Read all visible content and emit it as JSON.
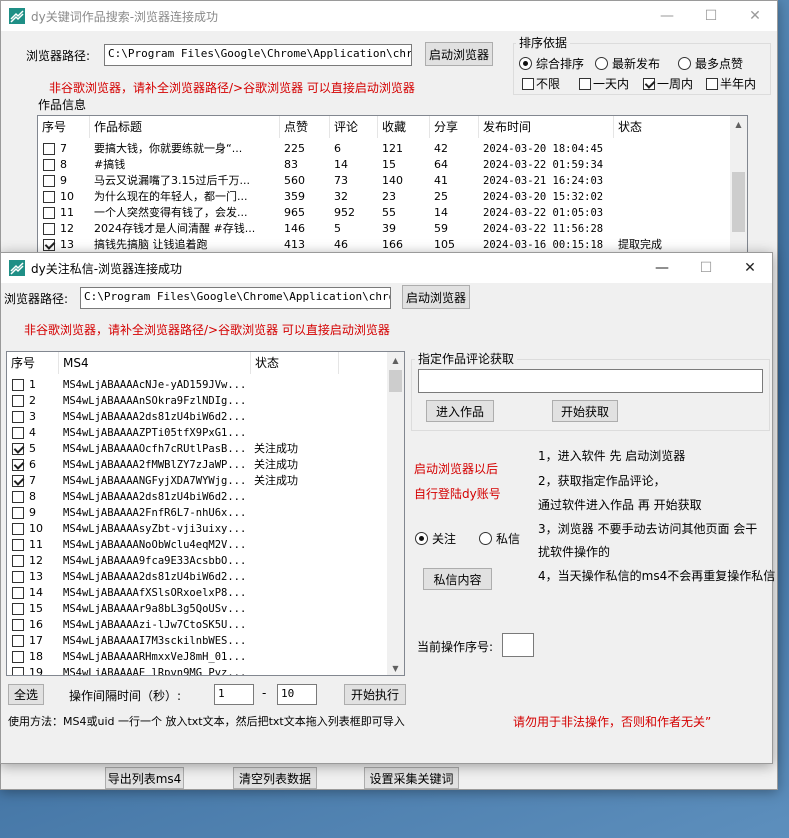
{
  "win1": {
    "title": "dy关键词作品搜索-浏览器连接成功",
    "minimize": "—",
    "maximize": "☐",
    "close": "✕",
    "browser_label": "浏览器路径:",
    "browser_path": "C:\\Program Files\\Google\\Chrome\\Application\\chrome.e",
    "launch_button": "启动浏览器",
    "notice": "非谷歌浏览器，请补全浏览器路径/>谷歌浏览器 可以直接启动浏览器",
    "works_label": "作品信息",
    "sort": {
      "title": "排序依据",
      "options": [
        "综合排序",
        "最新发布",
        "最多点赞"
      ],
      "selected": 0,
      "time_filters": [
        {
          "label": "不限",
          "checked": false
        },
        {
          "label": "一天内",
          "checked": false
        },
        {
          "label": "一周内",
          "checked": true
        },
        {
          "label": "半年内",
          "checked": false
        }
      ]
    },
    "table": {
      "headers": [
        "序号",
        "作品标题",
        "点赞",
        "评论",
        "收藏",
        "分享",
        "发布时间",
        "状态"
      ],
      "rows": [
        {
          "checked": false,
          "no": "7",
          "title": "要搞大钱，你就要练就一身“...",
          "likes": "225",
          "comments": "6",
          "favs": "121",
          "shares": "42",
          "time": "2024-03-20 18:04:45",
          "status": ""
        },
        {
          "checked": false,
          "no": "8",
          "title": "#搞钱",
          "likes": "83",
          "comments": "14",
          "favs": "15",
          "shares": "64",
          "time": "2024-03-22 01:59:34",
          "status": ""
        },
        {
          "checked": false,
          "no": "9",
          "title": "马云又说漏嘴了3.15过后千万...",
          "likes": "560",
          "comments": "73",
          "favs": "140",
          "shares": "41",
          "time": "2024-03-21 16:24:03",
          "status": ""
        },
        {
          "checked": false,
          "no": "10",
          "title": "为什么现在的年轻人，都一门...",
          "likes": "359",
          "comments": "32",
          "favs": "23",
          "shares": "25",
          "time": "2024-03-20 15:32:02",
          "status": ""
        },
        {
          "checked": false,
          "no": "11",
          "title": "一个人突然变得有钱了，会发...",
          "likes": "965",
          "comments": "952",
          "favs": "55",
          "shares": "14",
          "time": "2024-03-22 01:05:03",
          "status": ""
        },
        {
          "checked": false,
          "no": "12",
          "title": "2024存钱才是人间清醒 #存钱...",
          "likes": "146",
          "comments": "5",
          "favs": "39",
          "shares": "59",
          "time": "2024-03-22 11:56:28",
          "status": ""
        },
        {
          "checked": true,
          "no": "13",
          "title": "搞钱先搞脑 让钱追着跑",
          "likes": "413",
          "comments": "46",
          "favs": "166",
          "shares": "105",
          "time": "2024-03-16 00:15:18",
          "status": "提取完成"
        }
      ]
    },
    "bottom_buttons": [
      "导出列表ms4",
      "清空列表数据",
      "设置采集关键词"
    ]
  },
  "win2": {
    "title": "dy关注私信-浏览器连接成功",
    "minimize": "—",
    "maximize": "☐",
    "close": "✕",
    "browser_label": "浏览器路径:",
    "browser_path": "C:\\Program Files\\Google\\Chrome\\Application\\chrome.e",
    "launch_button": "启动浏览器",
    "notice": "非谷歌浏览器，请补全浏览器路径/>谷歌浏览器 可以直接启动浏览器",
    "list": {
      "headers": [
        "序号",
        "MS4",
        "状态"
      ],
      "rows": [
        {
          "checked": false,
          "no": "1",
          "ms4": "MS4wLjABAAAAcNJe-yAD159JVw...",
          "status": ""
        },
        {
          "checked": false,
          "no": "2",
          "ms4": "MS4wLjABAAAAnSOkra9FzlNDIg...",
          "status": ""
        },
        {
          "checked": false,
          "no": "3",
          "ms4": "MS4wLjABAAAA2ds81zU4biW6d2...",
          "status": ""
        },
        {
          "checked": false,
          "no": "4",
          "ms4": "MS4wLjABAAAAZPTi05tfX9PxG1...",
          "status": ""
        },
        {
          "checked": true,
          "no": "5",
          "ms4": "MS4wLjABAAAAOcfh7cRUtlPasB...",
          "status": "关注成功"
        },
        {
          "checked": true,
          "no": "6",
          "ms4": "MS4wLjABAAAA2fMWBlZY7zJaWP...",
          "status": "关注成功"
        },
        {
          "checked": true,
          "no": "7",
          "ms4": "MS4wLjABAAAANGFyjXDA7WYWjg...",
          "status": "关注成功"
        },
        {
          "checked": false,
          "no": "8",
          "ms4": "MS4wLjABAAAA2ds81zU4biW6d2...",
          "status": ""
        },
        {
          "checked": false,
          "no": "9",
          "ms4": "MS4wLjABAAAA2FnfR6L7-nhU6x...",
          "status": ""
        },
        {
          "checked": false,
          "no": "10",
          "ms4": "MS4wLjABAAAAsyZbt-vji3uixy...",
          "status": ""
        },
        {
          "checked": false,
          "no": "11",
          "ms4": "MS4wLjABAAAANoObWclu4eqM2V...",
          "status": ""
        },
        {
          "checked": false,
          "no": "12",
          "ms4": "MS4wLjABAAAA9fca9E33AcsbbO...",
          "status": ""
        },
        {
          "checked": false,
          "no": "13",
          "ms4": "MS4wLjABAAAA2ds81zU4biW6d2...",
          "status": ""
        },
        {
          "checked": false,
          "no": "14",
          "ms4": "MS4wLjABAAAAfXSlsORxoelxP8...",
          "status": ""
        },
        {
          "checked": false,
          "no": "15",
          "ms4": "MS4wLjABAAAAr9a8bL3g5QoUSv...",
          "status": ""
        },
        {
          "checked": false,
          "no": "16",
          "ms4": "MS4wLjABAAAAzi-lJw7CtoSK5U...",
          "status": ""
        },
        {
          "checked": false,
          "no": "17",
          "ms4": "MS4wLjABAAAAI7M3sckilnbWES...",
          "status": ""
        },
        {
          "checked": false,
          "no": "18",
          "ms4": "MS4wLjABAAAARHmxxVeJ8mH_01...",
          "status": ""
        },
        {
          "checked": false,
          "no": "19",
          "ms4": "MS4wLjABAAAAE lRpvn9MG Pvz...",
          "status": ""
        }
      ]
    },
    "comment_group_title": "指定作品评论获取",
    "comment_input": "",
    "enter_work_button": "进入作品",
    "start_fetch_button": "开始获取",
    "launch_hint_line1": "启动浏览器以后",
    "launch_hint_line2": "自行登陆dy账号",
    "mode": {
      "options": [
        "关注",
        "私信"
      ],
      "selected": 0
    },
    "pm_content_button": "私信内容",
    "instructions": [
      "1，进入软件 先 启动浏览器",
      "2，获取指定作品评论，",
      "通过软件进入作品 再 开始获取",
      "3，浏览器 不要手动去访问其他页面 会干",
      "扰软件操作的",
      "4，当天操作私信的ms4不会再重复操作私信"
    ],
    "current_seq_label": "当前操作序号:",
    "current_seq_value": "",
    "select_all_button": "全选",
    "interval_label": "操作间隔时间（秒）:",
    "interval_min": "1",
    "interval_dash": "-",
    "interval_max": "10",
    "start_button": "开始执行",
    "usage": "使用方法：MS4或uid 一行一个 放入txt文本，然后把txt文本拖入列表框即可导入",
    "warning": "请勿用于非法操作，否则和作者无关”"
  },
  "colors": {
    "notice_red": "#d40000"
  }
}
